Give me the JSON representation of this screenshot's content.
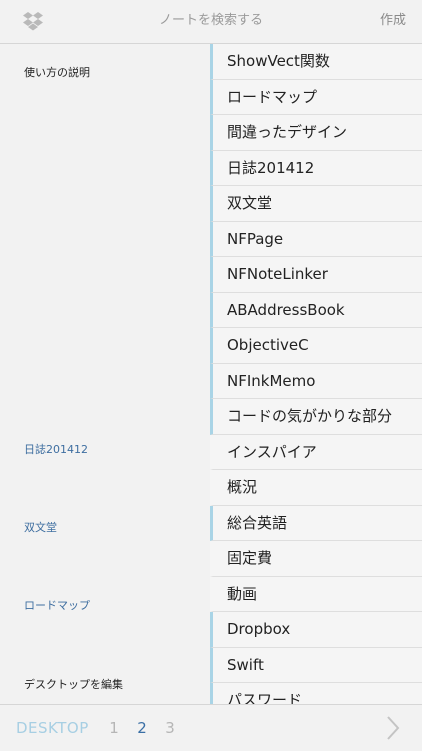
{
  "header": {
    "search_placeholder": "ノートを検索する",
    "create_label": "作成",
    "icon": "dropbox-icon"
  },
  "desktop": {
    "items": [
      {
        "label": "使い方の説明"
      },
      {
        "label": "日誌201412"
      },
      {
        "label": "双文堂"
      },
      {
        "label": "ロードマップ"
      },
      {
        "label": "デスクトップを編集"
      }
    ]
  },
  "notes": [
    {
      "title": "ShowVect関数"
    },
    {
      "title": "ロードマップ"
    },
    {
      "title": "間違ったデザイン"
    },
    {
      "title": "日誌201412"
    },
    {
      "title": "双文堂"
    },
    {
      "title": "NFPage"
    },
    {
      "title": "NFNoteLinker"
    },
    {
      "title": "ABAddressBook"
    },
    {
      "title": "ObjectiveC"
    },
    {
      "title": "NFInkMemo"
    },
    {
      "title": "コードの気がかりな部分"
    },
    {
      "title": "インスパイア"
    },
    {
      "title": "概況"
    },
    {
      "title": "総合英語"
    },
    {
      "title": "固定費"
    },
    {
      "title": "動画"
    },
    {
      "title": "Dropbox"
    },
    {
      "title": "Swift"
    },
    {
      "title": "パスワード"
    }
  ],
  "footer": {
    "desktop_label": "DESKTOP",
    "pages": [
      "1",
      "2",
      "3"
    ],
    "active_page": "2",
    "next_icon": "chevron-right-icon"
  },
  "colors": {
    "accent": "#a9d4e6",
    "link": "#3e6ea0",
    "active_page": "#3a6fa5"
  }
}
